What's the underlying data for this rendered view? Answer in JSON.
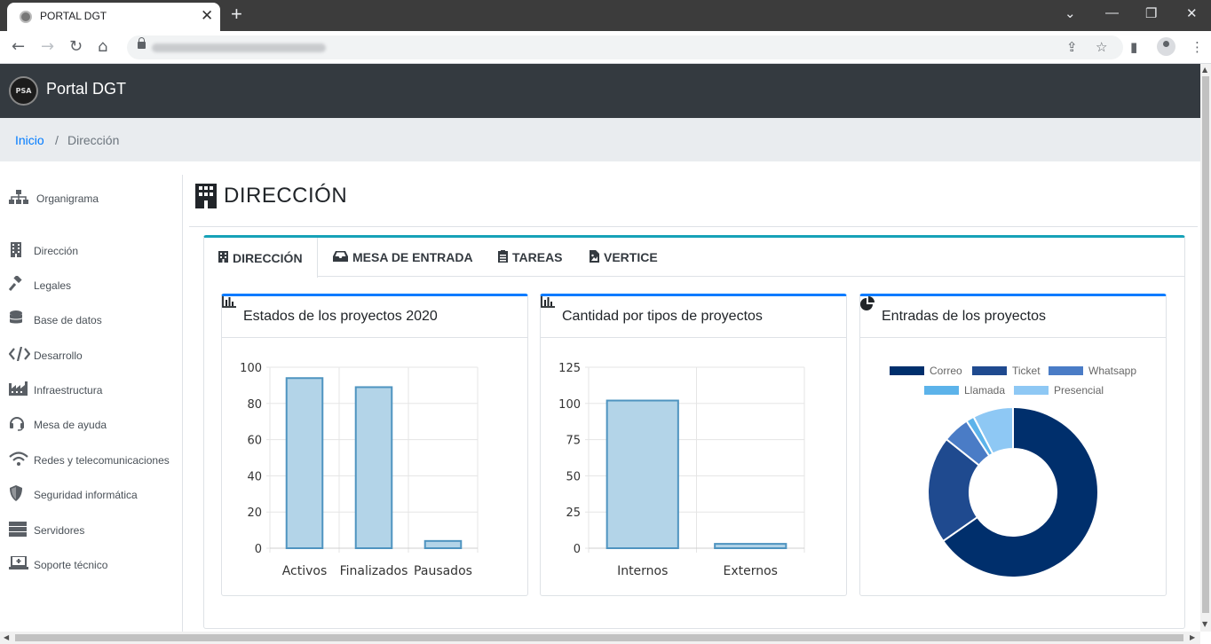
{
  "browser": {
    "tab_title": "PORTAL DGT",
    "tab_close": "✕",
    "new_tab": "+",
    "window_minimize": "—",
    "window_restore": "❐",
    "window_close": "✕"
  },
  "app": {
    "logo_text": "PSA",
    "brand": "Portal DGT"
  },
  "breadcrumb": {
    "home": "Inicio",
    "separator": "/",
    "current": "Dirección"
  },
  "sidebar": {
    "items": [
      {
        "label": "Organigrama",
        "icon": "sitemap-icon"
      },
      {
        "label": "Dirección",
        "icon": "building-icon"
      },
      {
        "label": "Legales",
        "icon": "gavel-icon"
      },
      {
        "label": "Base de datos",
        "icon": "database-icon"
      },
      {
        "label": "Desarrollo",
        "icon": "code-icon"
      },
      {
        "label": "Infraestructura",
        "icon": "industry-icon"
      },
      {
        "label": "Mesa de ayuda",
        "icon": "headset-icon"
      },
      {
        "label": "Redes y telecomunicaciones",
        "icon": "wifi-icon"
      },
      {
        "label": "Seguridad informática",
        "icon": "shield-icon"
      },
      {
        "label": "Servidores",
        "icon": "server-icon"
      },
      {
        "label": "Soporte técnico",
        "icon": "laptop-medical-icon"
      }
    ]
  },
  "page": {
    "title": "DIRECCIÓN"
  },
  "tabs": [
    {
      "label": "DIRECCIÓN",
      "icon": "building-icon",
      "active": true
    },
    {
      "label": "MESA DE ENTRADA",
      "icon": "inbox-icon",
      "active": false
    },
    {
      "label": "TAREAS",
      "icon": "clipboard-list-icon",
      "active": false
    },
    {
      "label": "VERTICE",
      "icon": "file-image-icon",
      "active": false
    }
  ],
  "cards": [
    {
      "title": "Estados de los proyectos 2020",
      "icon": "chart-bar-icon"
    },
    {
      "title": "Cantidad por tipos de proyectos",
      "icon": "chart-bar-icon"
    },
    {
      "title": "Entradas de los proyectos",
      "icon": "chart-pie-icon"
    }
  ],
  "colors": {
    "bar_fill": "#b3d4e8",
    "bar_stroke": "#4f94c0",
    "card_accent": "#007bff",
    "tab_accent": "#17a2b8",
    "topbar": "#343a40"
  },
  "chart_data": [
    {
      "type": "bar",
      "title": "Estados de los proyectos 2020",
      "categories": [
        "Activos",
        "Finalizados",
        "Pausados"
      ],
      "values": [
        94,
        89,
        4
      ],
      "ylim": [
        0,
        100
      ],
      "yticks": [
        "0",
        "20",
        "40",
        "60",
        "80",
        "100"
      ],
      "tick_values": [
        0,
        20,
        40,
        60,
        80,
        100
      ],
      "grid": true
    },
    {
      "type": "bar",
      "title": "Cantidad por tipos de proyectos",
      "categories": [
        "Internos",
        "Externos"
      ],
      "values": [
        102,
        3
      ],
      "ylim": [
        0,
        125
      ],
      "yticks": [
        "0",
        "25",
        "50",
        "75",
        "100",
        "125"
      ],
      "tick_values": [
        0,
        25,
        50,
        75,
        100,
        125
      ],
      "grid": true
    },
    {
      "type": "pie",
      "donut": true,
      "title": "Entradas de los proyectos",
      "legend_position": "top",
      "labels": [
        "Correo",
        "Ticket",
        "Whatsapp",
        "Llamada",
        "Presencial"
      ],
      "values": [
        64,
        20,
        5,
        1.5,
        7.5
      ],
      "colors": [
        "#002f6c",
        "#1f4a8f",
        "#4a7cc6",
        "#5cb3ea",
        "#8ec8f4"
      ]
    }
  ]
}
